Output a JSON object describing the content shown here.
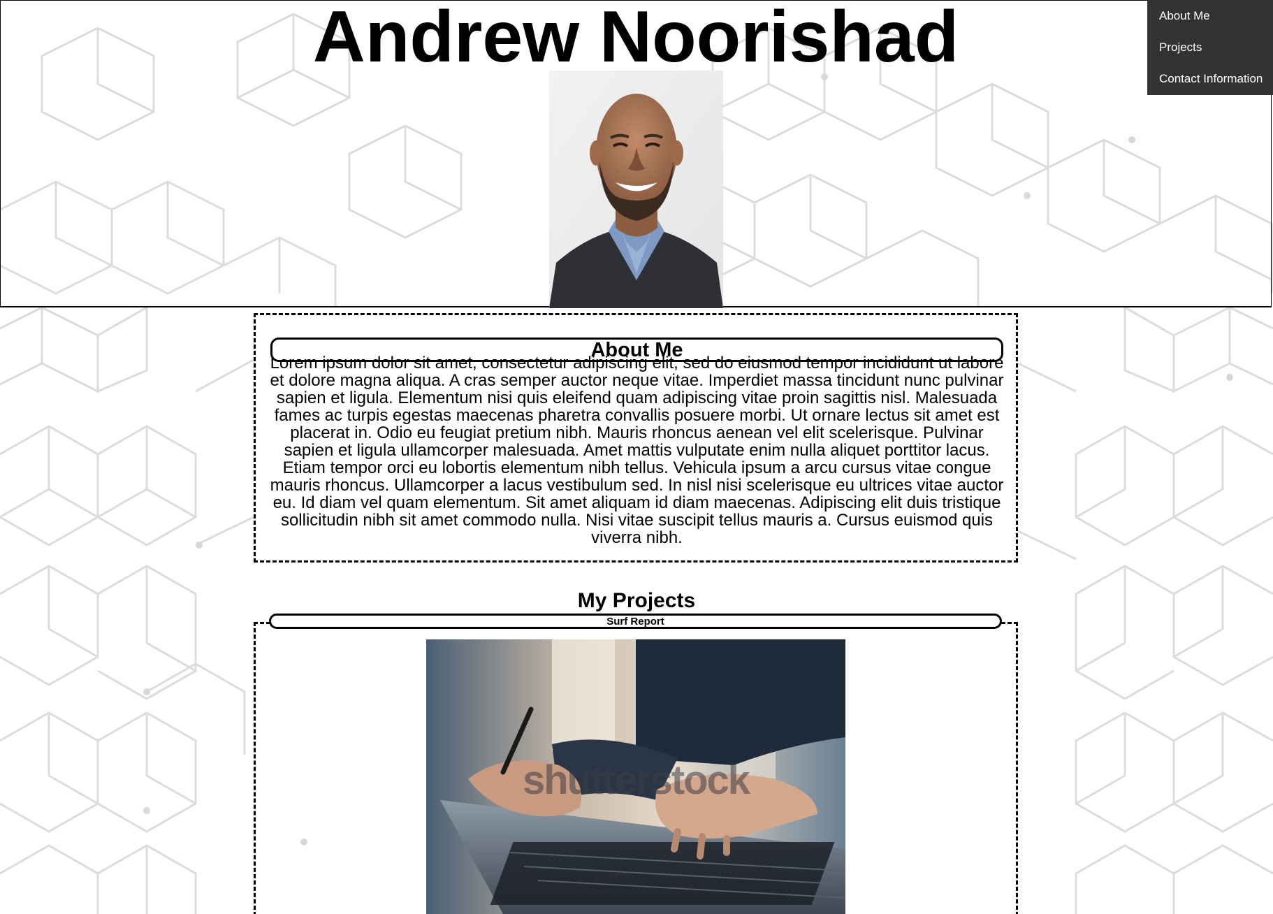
{
  "header": {
    "title": "Andrew Noorishad",
    "portrait_alt": "Portrait photo of Andrew Noorishad"
  },
  "nav": {
    "items": [
      {
        "label": "About Me"
      },
      {
        "label": "Projects"
      },
      {
        "label": "Contact Information"
      }
    ],
    "background": "#333333",
    "text_color": "#ffffff"
  },
  "about": {
    "heading": "About Me",
    "body": "Lorem ipsum dolor sit amet, consectetur adipiscing elit, sed do eiusmod tempor incididunt ut labore et dolore magna aliqua. A cras semper auctor neque vitae. Imperdiet massa tincidunt nunc pulvinar sapien et ligula. Elementum nisi quis eleifend quam adipiscing vitae proin sagittis nisl. Malesuada fames ac turpis egestas maecenas pharetra convallis posuere morbi. Ut ornare lectus sit amet est placerat in. Odio eu feugiat pretium nibh. Mauris rhoncus aenean vel elit scelerisque. Pulvinar sapien et ligula ullamcorper malesuada. Amet mattis vulputate enim nulla aliquet porttitor lacus. Etiam tempor orci eu lobortis elementum nibh tellus. Vehicula ipsum a arcu cursus vitae congue mauris rhoncus. Ullamcorper a lacus vestibulum sed. In nisl nisi scelerisque eu ultrices vitae auctor eu. Id diam vel quam elementum. Sit amet aliquam id diam maecenas. Adipiscing elit duis tristique sollicitudin nibh sit amet commodo nulla. Nisi vitae suscipit tellus mauris a. Cursus euismod quis viverra nibh."
  },
  "projects": {
    "heading": "My Projects",
    "items": [
      {
        "title": "Surf Report",
        "image_watermark": "shutterstock"
      }
    ]
  }
}
